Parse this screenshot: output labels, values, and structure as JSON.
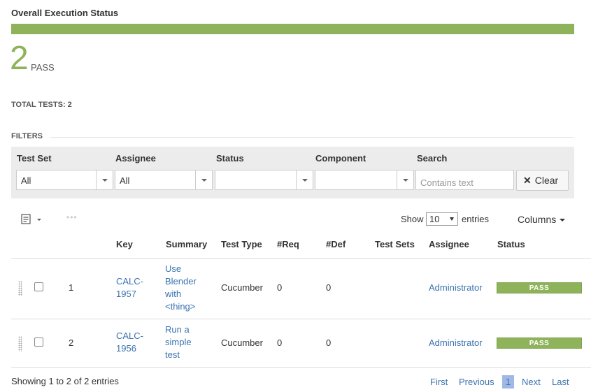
{
  "header": {
    "title": "Overall Execution Status",
    "progress_pass_fraction": 1.0,
    "count": "2",
    "count_label": "PASS",
    "total_label": "TOTAL TESTS:",
    "total_value": "2"
  },
  "filters": {
    "title": "FILTERS",
    "test_set": {
      "label": "Test Set",
      "value": "All"
    },
    "assignee": {
      "label": "Assignee",
      "value": "All"
    },
    "status": {
      "label": "Status",
      "value": ""
    },
    "component": {
      "label": "Component",
      "value": ""
    },
    "search": {
      "label": "Search",
      "placeholder": "Contains text"
    },
    "clear_label": "Clear"
  },
  "toolbar": {
    "show_label": "Show",
    "page_size": "10",
    "entries_label": "entries",
    "columns_label": "Columns"
  },
  "table": {
    "headers": {
      "key": "Key",
      "summary": "Summary",
      "test_type": "Test Type",
      "req": "#Req",
      "def": "#Def",
      "test_sets": "Test Sets",
      "assignee": "Assignee",
      "status": "Status"
    },
    "rows": [
      {
        "num": "1",
        "key_1": "CALC-",
        "key_2": "1957",
        "summary_1": "Use",
        "summary_2": "Blender",
        "summary_3": "with",
        "summary_4": "<thing>",
        "test_type": "Cucumber",
        "req": "0",
        "def": "0",
        "assignee": "Administrator",
        "status": "PASS"
      },
      {
        "num": "2",
        "key_1": "CALC-",
        "key_2": "1956",
        "summary_1": "Run a",
        "summary_2": "simple",
        "summary_3": "test",
        "test_type": "Cucumber",
        "req": "0",
        "def": "0",
        "assignee": "Administrator",
        "status": "PASS"
      }
    ]
  },
  "footer": {
    "showing": "Showing 1 to 2 of 2 entries",
    "first": "First",
    "previous": "Previous",
    "current_page": "1",
    "next": "Next",
    "last": "Last"
  },
  "colors": {
    "pass": "#8eb35b",
    "link": "#3b73af"
  }
}
